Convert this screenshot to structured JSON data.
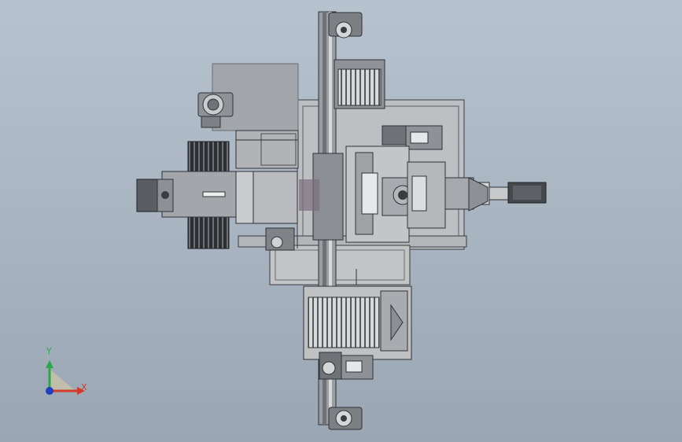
{
  "viewport": {
    "background_top": "#b7c2cf",
    "background_bottom": "#9aa6b3"
  },
  "triad": {
    "x_label": "X",
    "y_label": "Y",
    "x_color": "#d23a2a",
    "y_color": "#2aa84a",
    "z_color": "#1f3fbf"
  },
  "model": {
    "steel_color": "#a7aaae",
    "dark_color": "#4a4d52",
    "frame_color": "#bdbfc2"
  }
}
